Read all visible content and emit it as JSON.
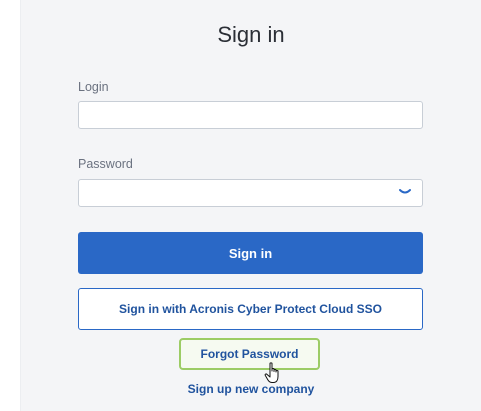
{
  "form": {
    "title": "Sign in",
    "login_label": "Login",
    "login_value": "",
    "password_label": "Password",
    "password_value": "",
    "password_toggle_icon": "eye-icon",
    "signin_button": "Sign in",
    "sso_button": "Sign in with Acronis Cyber Protect Cloud SSO",
    "forgot_link": "Forgot Password",
    "signup_link": "Sign up new company"
  },
  "colors": {
    "primary": "#2a68c6",
    "link": "#20539e",
    "highlight": "#9ccc65",
    "background": "#f4f5f7"
  }
}
